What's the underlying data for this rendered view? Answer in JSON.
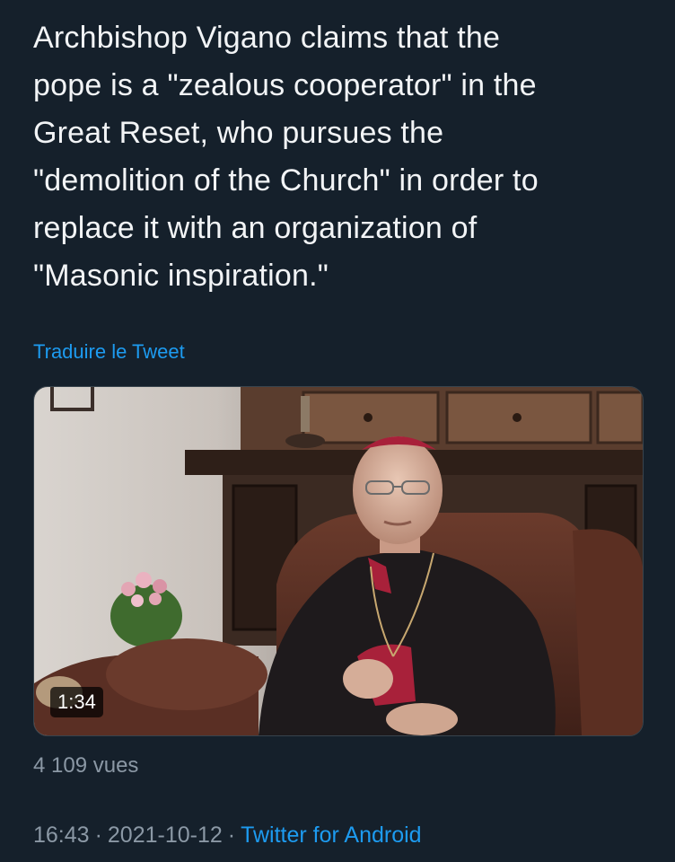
{
  "tweet": {
    "text_lines": [
      "Archbishop Vigano claims that the",
      "pope is a \"zealous cooperator\" in the",
      "Great Reset, who pursues the",
      "\"demolition of the Church\" in order to",
      "replace it with an organization of",
      "\"Masonic inspiration.\""
    ],
    "translate_label": "Traduire le Tweet",
    "video": {
      "duration": "1:34"
    },
    "views": "4 109 vues",
    "time": "16:43",
    "date": "2021-10-12",
    "separator": "·",
    "source": "Twitter for Android"
  },
  "colors": {
    "background": "#15202b",
    "text": "#f2f4f6",
    "link": "#1d9bf0",
    "secondary": "#8b98a5"
  }
}
